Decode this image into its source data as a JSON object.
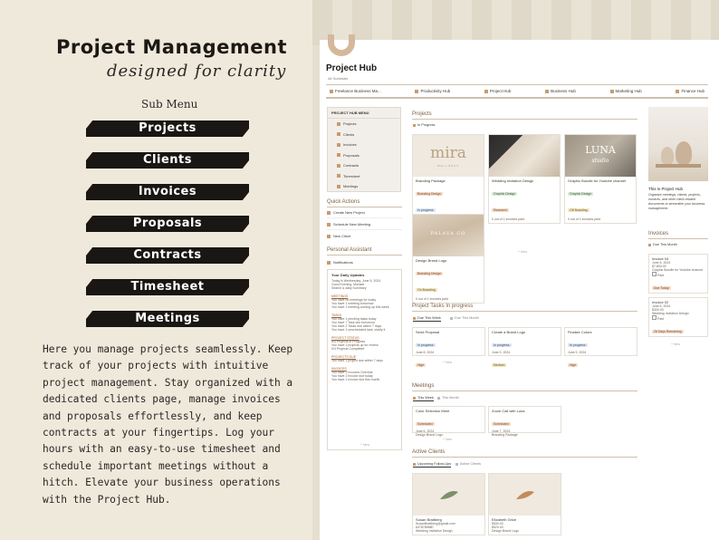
{
  "promo": {
    "title": "Project Management",
    "subtitle": "designed for clarity",
    "submenu_label": "Sub Menu",
    "menu": [
      "Projects",
      "Clients",
      "Invoices",
      "Proposals",
      "Contracts",
      "Timesheet",
      "Meetings"
    ],
    "description": "Here you manage projects seamlessly. Keep track of your projects with intuitive project management. Stay organized with a dedicated clients page, manage invoices and proposals effortlessly, and keep contracts at your fingertips. Log your hours with an easy-to-use timesheet and schedule important meetings without a hitch. Elevate your business operations with the Project Hub."
  },
  "hub": {
    "title": "Project Hub",
    "breadcrumb": "All Subtotals",
    "nav": [
      "Freelance Business Ma...",
      "Productivity Hub",
      "Project Hub",
      "Business Hub",
      "Marketing Hub",
      "Finance Hub"
    ],
    "sidebar": {
      "heading": "PROJECT HUB MENU",
      "items": [
        "Projects",
        "Clients",
        "Invoices",
        "Proposals",
        "Contracts",
        "Timesheet",
        "Meetings"
      ]
    },
    "quick_actions": {
      "title": "Quick Actions",
      "items": [
        "Create New Project",
        "Schedule New Meeting",
        "New Client"
      ]
    },
    "assistant": {
      "title": "Personal Assistant",
      "notif": "Notifications",
      "updates": "Your Daily Updates",
      "lines": [
        "Today is Wednesday, June 5, 2024",
        "Good Evening, Michael",
        "Search & daily Summary"
      ],
      "groups": [
        {
          "name": "MEETINGS",
          "items": [
            "You have no meetings for today",
            "You have 1 meeting tomorrow",
            "You have 1 meeting coming up this week"
          ]
        },
        {
          "name": "TASKS",
          "items": [
            "You have 1 pending tasks today",
            "You have 7 Task due tomorrow",
            "You have 2 Tasks due within 7 days",
            "You have 1 unscheduled task, clarify it"
          ]
        },
        {
          "name": "PROJECT STATUS",
          "items": [
            "6/4 Projects in Progress",
            "You have 2 projects up for review",
            "0/4 Projects Completed"
          ]
        },
        {
          "name": "PROJECTS DUE",
          "items": [
            "You have 1 project due within 7 days"
          ]
        },
        {
          "name": "INVOICES",
          "items": [
            "You have 2 Invoices Overdue",
            "You have 2 Invoice due today",
            "You have 1 Invoice due this month"
          ]
        }
      ],
      "new": "+ New"
    },
    "projects": {
      "title": "Projects",
      "filter": "In Progress",
      "cards": [
        {
          "name": "Branding Package",
          "tags": [
            "Branding Design",
            "In progress"
          ],
          "meta": "0 out of 1 invoices paid",
          "logo": "mira",
          "logo_sub": "WELLNESS"
        },
        {
          "name": "Wedding Invitation Design",
          "tags": [
            "Graphic Design",
            "Research"
          ],
          "meta": "0 out of 1 invoices paid",
          "logo": "",
          "logo_sub": ""
        },
        {
          "name": "Graphic Bundle for Youtube channel",
          "tags": [
            "Graphic Design",
            "Off Boarding"
          ],
          "meta": "0 out of 1 invoices paid",
          "logo": "LUNA",
          "logo_sub": "studio"
        },
        {
          "name": "Design Brand Logo",
          "tags": [
            "Branding Design",
            "On Boarding"
          ],
          "meta": "0 out of 1 invoices paid",
          "logo": "PALAVA CO",
          "logo_sub": ""
        }
      ],
      "new": "+ New"
    },
    "tasks": {
      "title": "Project Tasks In progress",
      "tabs": [
        "Due This Week",
        "Due This Month"
      ],
      "items": [
        {
          "name": "Send Proposal",
          "status": "In progress",
          "date": "June 8, 2024",
          "priority": "High"
        },
        {
          "name": "Create a Brand Logo",
          "status": "In progress",
          "date": "June 9, 2024",
          "priority": "Medium"
        },
        {
          "name": "Finalize Colors",
          "status": "In progress",
          "date": "June 9, 2024",
          "priority": "High"
        }
      ],
      "new": "+ New"
    },
    "meetings": {
      "title": "Meetings",
      "tabs": [
        "This Week",
        "This Month"
      ],
      "items": [
        {
          "name": "Color Selection Meet",
          "tag": "Scheduled",
          "date": "June 6, 2024",
          "project": "Design Brand Logo"
        },
        {
          "name": "Zoom Call with Luna",
          "tag": "Scheduled",
          "date": "June 7, 2024",
          "project": "Branding Package"
        }
      ],
      "new": "+ New"
    },
    "clients": {
      "title": "Active Clients",
      "tabs": [
        "Upcoming Follow-Ups",
        "Active Clients"
      ],
      "items": [
        {
          "name": "Susan Brattberg",
          "email": "SusanBrattberg@gmail.com",
          "phone": "6078789880",
          "project": "Wedding Invitation Design"
        },
        {
          "name": "Elizabeth Grice",
          "email": "$530.00",
          "phone": "$520.00",
          "project": "Design Brand Logo"
        }
      ]
    },
    "about": {
      "title": "This Is Project Hub",
      "text": "Organize meetings, clients, projects, invoices, and other client-related documents to streamline your business management."
    },
    "invoices": {
      "title": "Invoices",
      "tab": "Due This Month",
      "items": [
        {
          "name": "Invoice 04",
          "date": "June 5, 2024",
          "amount": "$7,800.00",
          "project": "Graphic Bundle for Youtube channel",
          "status": "Paid",
          "due": "Due Today"
        },
        {
          "name": "Invoice 02",
          "date": "June 6, 2024",
          "amount": "$300.00",
          "project": "Wedding Invitation Design",
          "status": "Paid",
          "due": "26 Days Remaining"
        }
      ],
      "new": "+ New"
    }
  },
  "colors": {
    "pill": "#191613",
    "accent": "#c79b6f",
    "section": "#7e5f40",
    "arch": "#d5b89c"
  }
}
